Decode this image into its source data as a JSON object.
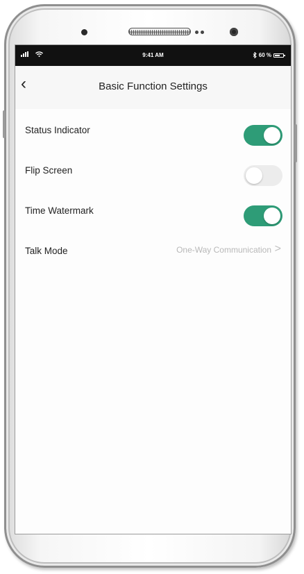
{
  "status_bar": {
    "time": "9:41 AM",
    "battery_text": "60 %",
    "battery_level": 0.6,
    "signal_icon": "signal-icon",
    "wifi_icon": "wifi-icon",
    "bluetooth_icon": "bluetooth-icon"
  },
  "header": {
    "back_icon": "chevron-left-icon",
    "back_glyph": "‹",
    "title": "Basic Function Settings"
  },
  "settings": {
    "status_indicator": {
      "label": "Status Indicator",
      "enabled": true
    },
    "flip_screen": {
      "label": "Flip Screen",
      "enabled": false
    },
    "time_watermark": {
      "label": "Time Watermark",
      "enabled": true
    },
    "talk_mode": {
      "label": "Talk Mode",
      "value": "One-Way Communication",
      "chevron": ">"
    }
  },
  "colors": {
    "toggle_on": "#2e9c77",
    "toggle_off": "#ececec",
    "status_bar_bg": "#111111"
  }
}
